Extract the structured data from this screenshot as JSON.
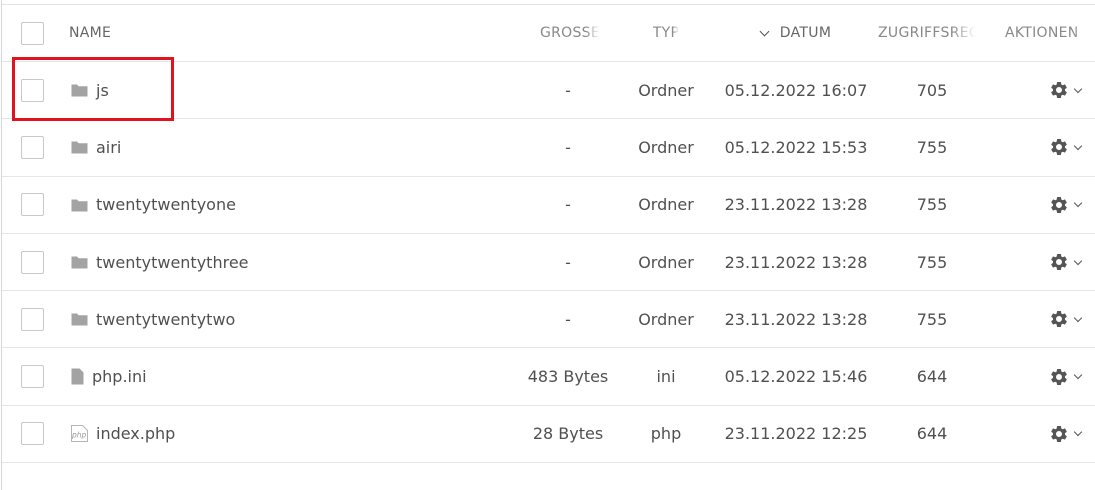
{
  "columns": {
    "name": "NAME",
    "size": "GRÖSSE",
    "type": "TYP",
    "date": "DATUM",
    "permissions": "ZUGRIFFSREC",
    "actions": "AKTIONEN"
  },
  "files": [
    {
      "name": "js",
      "icon": "folder-icon",
      "size": "-",
      "type": "Ordner",
      "date": "05.12.2022 16:07",
      "permissions": "705"
    },
    {
      "name": "airi",
      "icon": "folder-icon",
      "size": "-",
      "type": "Ordner",
      "date": "05.12.2022 15:53",
      "permissions": "755"
    },
    {
      "name": "twentytwentyone",
      "icon": "folder-icon",
      "size": "-",
      "type": "Ordner",
      "date": "23.11.2022 13:28",
      "permissions": "755"
    },
    {
      "name": "twentytwentythree",
      "icon": "folder-icon",
      "size": "-",
      "type": "Ordner",
      "date": "23.11.2022 13:28",
      "permissions": "755"
    },
    {
      "name": "twentytwentytwo",
      "icon": "folder-icon",
      "size": "-",
      "type": "Ordner",
      "date": "23.11.2022 13:28",
      "permissions": "755"
    },
    {
      "name": "php.ini",
      "icon": "file-icon",
      "size": "483 Bytes",
      "type": "ini",
      "date": "05.12.2022 15:46",
      "permissions": "644"
    },
    {
      "name": "index.php",
      "icon": "php-file-icon",
      "size": "28 Bytes",
      "type": "php",
      "date": "23.11.2022 12:25",
      "permissions": "644"
    }
  ],
  "icons": {
    "sort": "chevron-down-icon",
    "actions": "gear-icon",
    "actions_dropdown": "chevron-down-icon"
  },
  "colors": {
    "highlight": "#e0141e",
    "icon": "#9a9a9a",
    "border": "#e6e6e6"
  }
}
